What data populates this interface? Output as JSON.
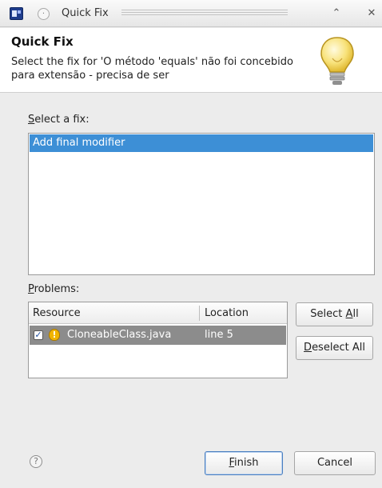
{
  "window": {
    "title": "Quick Fix",
    "minimize_glyph": "⌃",
    "close_glyph": "✕",
    "menu_glyph": "·"
  },
  "header": {
    "title": "Quick Fix",
    "message": "Select the fix for 'O método 'equals' não foi concebido para extensão - precisa de ser",
    "icon": "lightbulb-icon"
  },
  "fixes": {
    "label_mnemonic": "S",
    "label_rest": "elect a fix:",
    "items": [
      "Add final modifier"
    ]
  },
  "problems": {
    "label_mnemonic": "P",
    "label_rest": "roblems:",
    "columns": [
      "Resource",
      "Location"
    ],
    "rows": [
      {
        "resource": "CloneableClass.java",
        "location": "line 5",
        "checked": true,
        "icon": "warning-icon"
      }
    ]
  },
  "buttons": {
    "select_all_pre": "Select ",
    "select_all_mn": "A",
    "select_all_post": "ll",
    "deselect_all_pre": "",
    "deselect_all_mn": "D",
    "deselect_all_post": "eselect All",
    "finish_pre": "",
    "finish_mn": "F",
    "finish_post": "inish",
    "cancel": "Cancel"
  },
  "footer": {
    "help_glyph": "?"
  },
  "colors": {
    "selection": "#3d8fd6",
    "row_selected": "#8c8c8c",
    "dialog_bg": "#ececec"
  }
}
